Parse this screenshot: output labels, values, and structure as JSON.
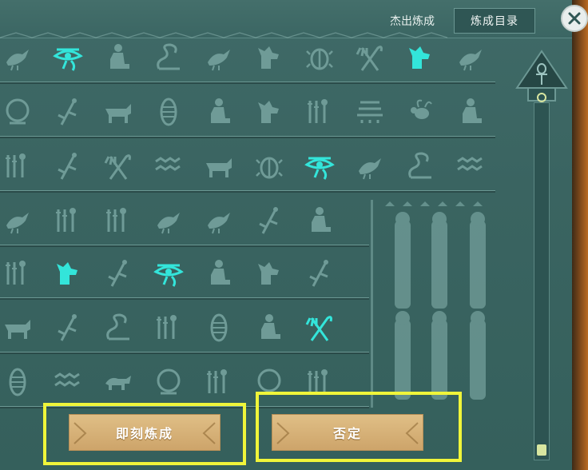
{
  "header": {
    "output_label": "杰出炼成",
    "catalog_button": "炼成目录"
  },
  "buttons": {
    "craft_now": "即刻炼成",
    "cancel": "否定"
  },
  "colors": {
    "highlight_glyph": "#33e5da",
    "dim_glyph": "#6f9b97",
    "button_scroll": "#d8b47a",
    "annotation_box": "#f0f53a"
  },
  "glyph_rows": [
    [
      "bird-icon",
      "eye-of-horus-icon",
      "seated-figure-icon",
      "snake-icon",
      "bird-icon",
      "jackal-icon",
      "scarab-icon",
      "crook-flail-icon",
      "jackal-icon",
      "bird-icon"
    ],
    [
      "shen-ring-icon",
      "reed-icon",
      "cow-icon",
      "mummy-icon",
      "seated-figure-icon",
      "jackal-icon",
      "tools-icon",
      "basket-icon",
      "bee-icon",
      "seated-figure-icon"
    ],
    [
      "tools-icon",
      "reed-icon",
      "crook-flail-icon",
      "water-icon",
      "cow-icon",
      "scarab-icon",
      "eye-of-horus-icon",
      "bird-icon",
      "snake-icon",
      "water-icon"
    ],
    [
      "bird-icon",
      "tools-icon",
      "tools-icon",
      "bird-icon",
      "bird-icon",
      "reed-icon",
      "seated-figure-icon"
    ],
    [
      "tools-icon",
      "jackal-icon",
      "reed-icon",
      "eye-of-horus-icon",
      "seated-figure-icon",
      "jackal-icon",
      "reed-icon"
    ],
    [
      "cow-icon",
      "reed-icon",
      "snake-icon",
      "tools-icon",
      "mummy-icon",
      "seated-figure-icon",
      "crook-flail-icon"
    ],
    [
      "mummy-icon",
      "water-icon",
      "lion-icon",
      "shen-ring-icon",
      "tools-icon",
      "shen-ring-icon",
      "tools-icon"
    ]
  ],
  "lit_glyphs": [
    [
      0,
      1
    ],
    [
      0,
      8
    ],
    [
      2,
      6
    ],
    [
      4,
      1
    ],
    [
      4,
      3
    ],
    [
      5,
      6
    ]
  ],
  "scroll_level": 0.0
}
